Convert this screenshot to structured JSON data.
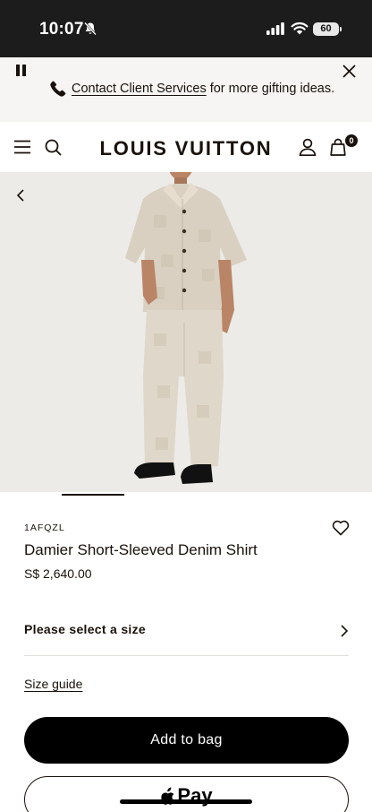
{
  "status_bar": {
    "time": "10:07",
    "battery": "60"
  },
  "promo": {
    "link_text": "Contact Client Services",
    "rest_text": "for more gifting ideas."
  },
  "header": {
    "brand": "LOUIS VUITTON",
    "bag_count": "0"
  },
  "product": {
    "sku": "1AFQZL",
    "name": "Damier Short-Sleeved Denim Shirt",
    "price": "S$ 2,640.00",
    "image_position": 1
  },
  "size": {
    "label": "Please select a size",
    "guide": "Size guide"
  },
  "actions": {
    "add_to_bag": "Add to bag",
    "apple_pay": "Pay"
  },
  "icons": {
    "menu": "menu-icon",
    "search": "search-icon",
    "account": "account-icon",
    "bag": "bag-icon",
    "wishlist": "heart-icon",
    "back": "chevron-left-icon",
    "close": "close-icon",
    "pause": "pause-icon",
    "phone": "phone-icon"
  },
  "colors": {
    "brand_dark": "#19110b",
    "status_bar": "#1c1c1c",
    "promo_bg": "#f6f5f3",
    "image_bg": "#ecebe8"
  }
}
